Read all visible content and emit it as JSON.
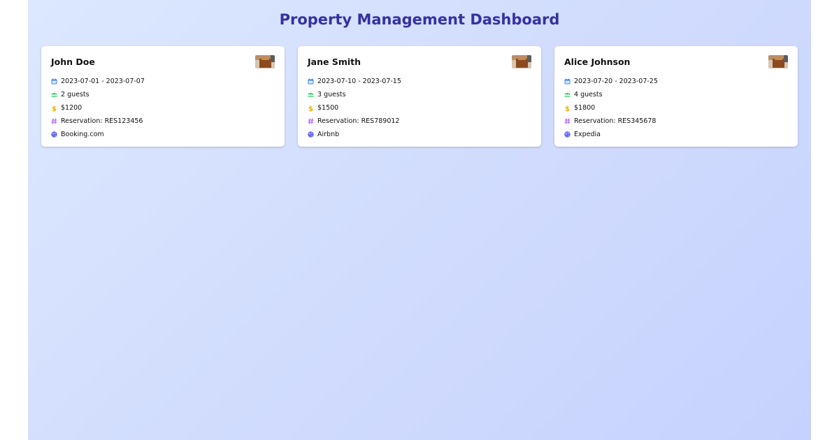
{
  "page": {
    "title": "Property Management Dashboard"
  },
  "colors": {
    "title": "#3730a3",
    "calendar": "#3b82f6",
    "guests": "#22c55e",
    "price": "#eab308",
    "reservation": "#a855f7",
    "source": "#6366f1"
  },
  "bookings": [
    {
      "name": "John Doe",
      "dates": "2023-07-01 - 2023-07-07",
      "guests": "2 guests",
      "price": "$1200",
      "reservation": "Reservation: RES123456",
      "source": "Booking.com"
    },
    {
      "name": "Jane Smith",
      "dates": "2023-07-10 - 2023-07-15",
      "guests": "3 guests",
      "price": "$1500",
      "reservation": "Reservation: RES789012",
      "source": "Airbnb"
    },
    {
      "name": "Alice Johnson",
      "dates": "2023-07-20 - 2023-07-25",
      "guests": "4 guests",
      "price": "$1800",
      "reservation": "Reservation: RES345678",
      "source": "Expedia"
    }
  ]
}
